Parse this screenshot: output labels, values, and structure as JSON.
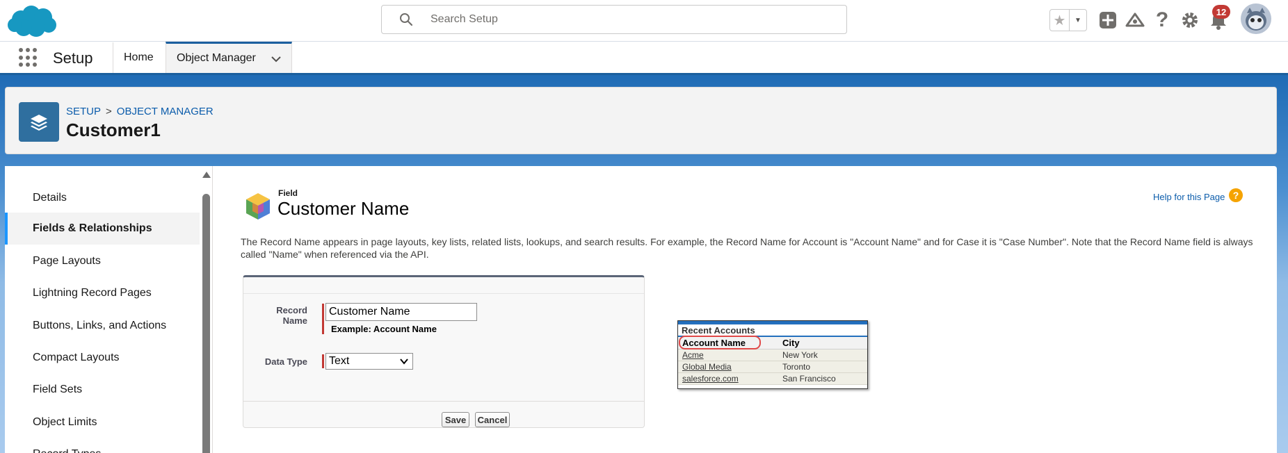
{
  "header": {
    "search_placeholder": "Search Setup",
    "notification_count": "12",
    "icons": [
      "salesforce-cloud-logo",
      "search-icon",
      "star-icon",
      "chevron-down-icon",
      "add-icon",
      "trailhead-icon",
      "help-icon",
      "gear-icon",
      "bell-icon",
      "avatar"
    ]
  },
  "context_bar": {
    "app_name": "Setup",
    "tabs": [
      {
        "label": "Home"
      },
      {
        "label": "Object Manager"
      }
    ]
  },
  "page_header": {
    "breadcrumb": [
      "SETUP",
      ">",
      "OBJECT MANAGER"
    ],
    "title": "Customer1"
  },
  "sidebar": {
    "items": [
      {
        "label": "Details",
        "active": false
      },
      {
        "label": "Fields & Relationships",
        "active": true
      },
      {
        "label": "Page Layouts",
        "active": false
      },
      {
        "label": "Lightning Record Pages",
        "active": false
      },
      {
        "label": "Buttons, Links, and Actions",
        "active": false
      },
      {
        "label": "Compact Layouts",
        "active": false
      },
      {
        "label": "Field Sets",
        "active": false
      },
      {
        "label": "Object Limits",
        "active": false
      },
      {
        "label": "Record Types",
        "active": false
      }
    ]
  },
  "content": {
    "kicker": "Field",
    "title": "Customer Name",
    "help_link": "Help for this Page",
    "description": "The Record Name appears in page layouts, key lists, related lists, lookups, and search results. For example, the Record Name for Account is \"Account Name\" and for Case it is \"Case Number\". Note that the Record Name field is always called \"Name\" when referenced via the API.",
    "form": {
      "record_name_label": "Record Name",
      "record_name_value": "Customer Name",
      "example_text": "Example:  Account Name",
      "data_type_label": "Data Type",
      "data_type_value": "Text",
      "save_label": "Save",
      "cancel_label": "Cancel"
    },
    "preview": {
      "title": "Recent Accounts",
      "columns": [
        "Account Name",
        "City"
      ],
      "rows": [
        [
          "Acme",
          "New York"
        ],
        [
          "Global Media",
          "Toronto"
        ],
        [
          "salesforce.com",
          "San Francisco"
        ]
      ]
    }
  },
  "colors": {
    "brand_blue": "#1b96ff",
    "header_icon_blue": "#2f6f9f",
    "link": "#0b5cab",
    "required": "#c23934",
    "badge": "#c23934"
  }
}
